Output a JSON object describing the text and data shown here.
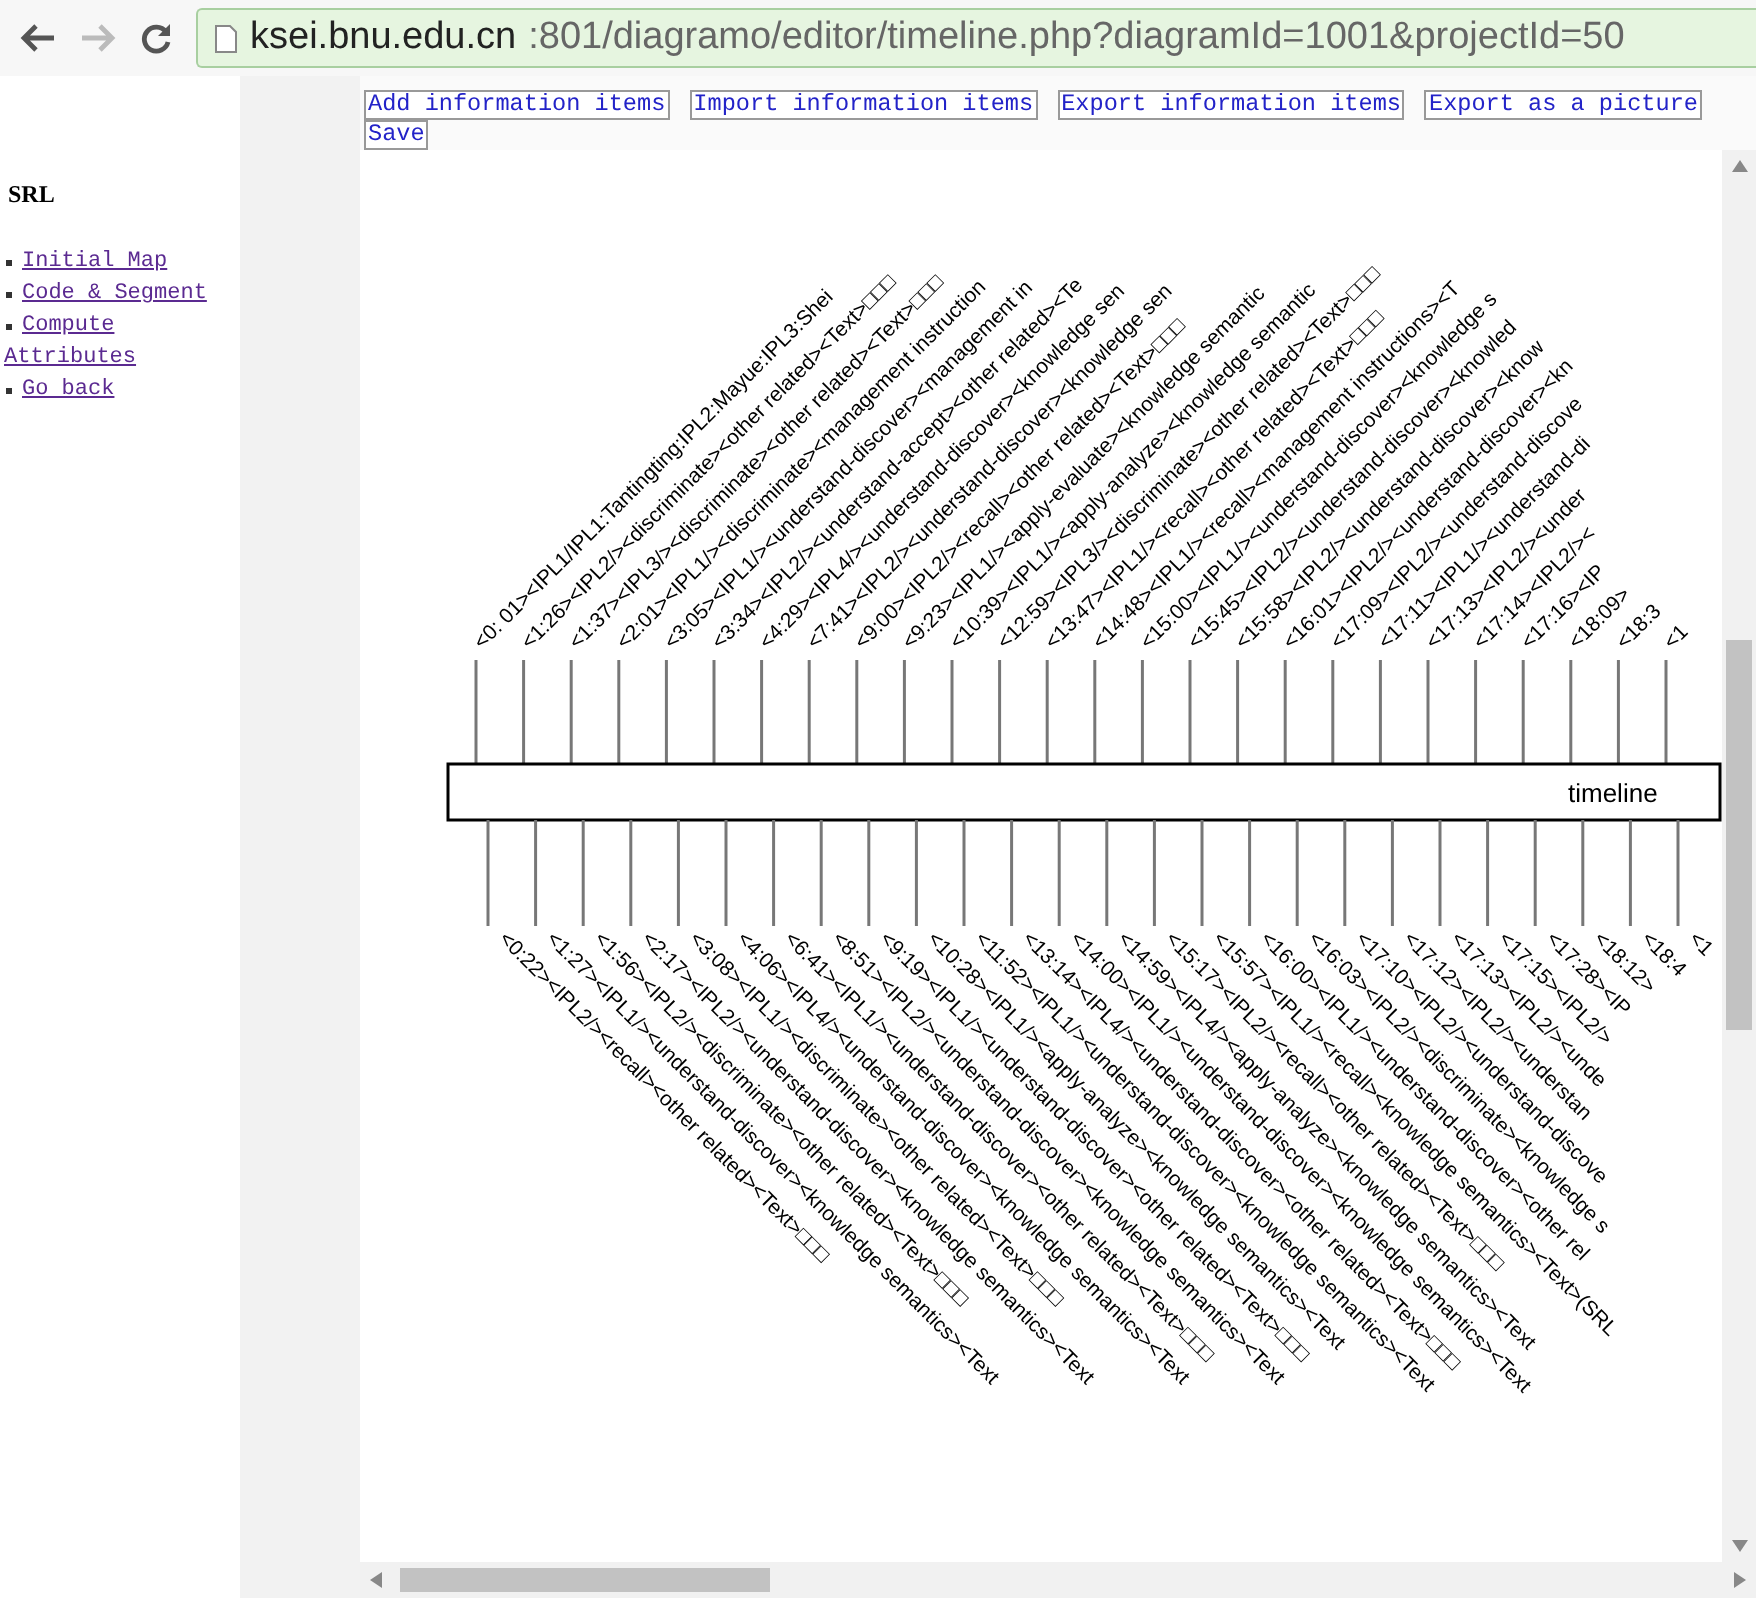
{
  "browser": {
    "address_bar": {
      "host": "ksei.bnu.edu.cn",
      "path": ":801/diagramo/editor/timeline.php?diagramId=1001&projectId=50"
    }
  },
  "sidebar": {
    "title": "SRL",
    "links": [
      "Initial Map",
      "Code & Segment",
      "Compute Attributes",
      "Go back"
    ]
  },
  "toolbar": {
    "buttons": [
      "Add information items",
      "Import information items",
      "Export information items",
      "Export as a picture",
      "Save"
    ]
  },
  "timeline": {
    "title": "timeline",
    "top_labels": [
      "<0: 01><IPL1/IPL1:Tantingting:IPL2:Mayue:IPL3:Shei",
      "<1:26><IPL2/><discriminate><other related><Text>□□□",
      "<1:37><IPL3/><discriminate><other related><Text>□□□",
      "<2:01><IPL1/><discriminate><management instruction",
      "<3:05><IPL1/><understand-discover><management in",
      "<3:34><IPL2/><understand-accept><other related><Te",
      "<4:29><IPL4/><understand-discover><knowledge sen",
      "<7:41><IPL2/><understand-discover><knowledge sen",
      "<9:00><IPL2/><recall><other related><Text>□□□",
      "<9:23><IPL1/><apply-evaluate><knowledge semantic",
      "<10:39><IPL1/><apply-analyze><knowledge semantic",
      "<12:59><IPL3/><discriminate><other related><Text>□□□",
      "<13:47><IPL1/><recall><other related><Text>□□□",
      "<14:48><IPL1/><recall><management instructions><T",
      "<15:00><IPL1/><understand-discover><knowledge s",
      "<15:45><IPL2/><understand-discover><knowled",
      "<15:58><IPL2/><understand-discover><know",
      "<16:01><IPL2/><understand-discover><kn",
      "<17:09><IPL2/><understand-discove",
      "<17:11><IPL1/><understand-di",
      "<17:13><IPL2/><under",
      "<17:14><IPL2/><",
      "<17:16><IP",
      "<18:09>",
      "<18:3",
      "<1"
    ],
    "bottom_labels": [
      "<0:22><IPL2/><recall><other related><Text>□□□",
      "<1:27><IPL1/><understand-discover><knowledge semantics><Text",
      "<1:56><IPL2/><discriminate><other related><Text>□□□",
      "<2:17><IPL2/><understand-discover><knowledge semantics><Text",
      "<3:08><IPL1/><discriminate><other related><Text>□□□",
      "<4:06><IPL4/><understand-discover><knowledge semantics><Text",
      "<6:41><IPL1/><understand-discover><other related><Text>□□□",
      "<8:51><IPL2/><understand-discover><knowledge semantics><Text",
      "<9:19><IPL1/><understand-discover><other related><Text>□□□",
      "<10:28><IPL1/><apply-analyze><knowledge semantics><Text",
      "<11:52><IPL1/><understand-discover><knowledge semantics><Text",
      "<13:14><IPL4/><understand-discover><other related><Text>□□□",
      "<14:00><IPL1/><understand-discover><knowledge semantics><Text",
      "<14:59><IPL4/><apply-analyze><knowledge semantics><Text",
      "<15:17><IPL2/><recall><other related><Text>□□□",
      "<15:57><IPL1/><recall><knowledge semantics><Text>(SRL",
      "<16:00><IPL1/><understand-discover><other rel",
      "<16:03><IPL2/><discriminate><knowledge s",
      "<17:10><IPL2/><understand-discove",
      "<17:12><IPL2/><understan",
      "<17:13><IPL2/><unde",
      "<17:15><IPL2/>",
      "<17:28><IP",
      "<18:12>",
      "<18:4",
      "<1"
    ]
  }
}
